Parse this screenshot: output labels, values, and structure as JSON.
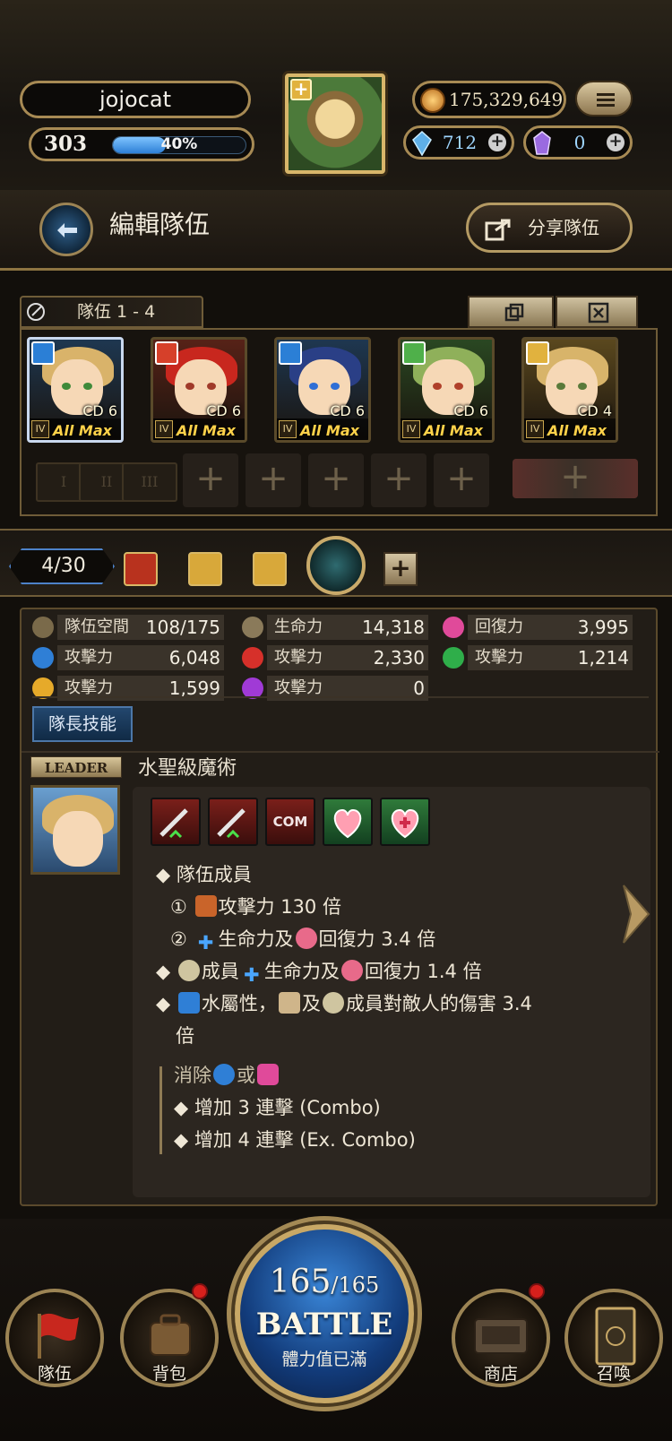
{
  "header": {
    "player_name": "jojocat",
    "level": "303",
    "exp_percent_text": "40%",
    "exp_fraction": 0.4,
    "coins": "175,329,649",
    "diamonds": "712",
    "crystals": "0"
  },
  "edit_bar": {
    "title": "編輯隊伍",
    "share_label": "分享隊伍"
  },
  "team": {
    "label": "隊伍 1 - 4",
    "members": [
      {
        "cd": "CD 6",
        "rank": "IV",
        "status": "All Max",
        "attr_color": "#2b7fd6",
        "hair": "#d9b36a",
        "eye": "#3f8a3a"
      },
      {
        "cd": "CD 6",
        "rank": "IV",
        "status": "All Max",
        "attr_color": "#d6402a",
        "hair": "#c8271e",
        "eye": "#a03a2a"
      },
      {
        "cd": "CD 6",
        "rank": "IV",
        "status": "All Max",
        "attr_color": "#2b7fd6",
        "hair": "#2a3f86",
        "eye": "#2f6fd6"
      },
      {
        "cd": "CD 6",
        "rank": "IV",
        "status": "All Max",
        "attr_color": "#4fb04a",
        "hair": "#8fb05a",
        "eye": "#b0402a"
      },
      {
        "cd": "CD 4",
        "rank": "IV",
        "status": "All Max",
        "attr_color": "#e1b23e",
        "hair": "#d8b46a",
        "eye": "#5a7a3a"
      }
    ],
    "sub_slot_labels": [
      "I",
      "II",
      "III"
    ],
    "cost": "4/30"
  },
  "stats": [
    {
      "icon": "team-space-icon",
      "label": "隊伍空間",
      "value": "108/175",
      "color": "#7a6a4a"
    },
    {
      "icon": "hp-icon",
      "label": "生命力",
      "value": "14,318",
      "color": "#8a7a5a"
    },
    {
      "icon": "recovery-icon",
      "label": "回復力",
      "value": "3,995",
      "color": "#e04a9a"
    },
    {
      "icon": "water-icon",
      "label": "攻擊力",
      "value": "6,048",
      "color": "#2f7fd6"
    },
    {
      "icon": "fire-icon",
      "label": "攻擊力",
      "value": "2,330",
      "color": "#d6302a"
    },
    {
      "icon": "wood-icon",
      "label": "攻擊力",
      "value": "1,214",
      "color": "#2fae4a"
    },
    {
      "icon": "light-icon",
      "label": "攻擊力",
      "value": "1,599",
      "color": "#e6aa2a"
    },
    {
      "icon": "dark-icon",
      "label": "攻擊力",
      "value": "0",
      "color": "#a03ad6"
    }
  ],
  "leader": {
    "tab_label": "隊長技能",
    "tag": "LEADER",
    "skill_name": "水聖級魔術",
    "lines": {
      "b1": "隊伍成員",
      "b1_1a": "①",
      "b1_1b": "攻擊力 130 倍",
      "b1_2a": "②",
      "b1_2b": "生命力及",
      "b1_2c": "回復力 3.4 倍",
      "b2a": "成員",
      "b2b": "生命力及",
      "b2c": "回復力 1.4 倍",
      "b3a": "水屬性，",
      "b3b": "及",
      "b3c": "成員對敵人的傷害 3.4",
      "b3d": "倍",
      "c1a": "消除",
      "c1b": "或",
      "c2": "增加 3 連擊 (Combo)",
      "c3": "增加 4 連擊 (Ex. Combo)"
    },
    "skill_icons": [
      "attack-up-icon",
      "attack-up-icon",
      "combo-icon",
      "heart-icon",
      "heal-icon"
    ],
    "com_text": "COM"
  },
  "nav": {
    "team": "隊伍",
    "bag": "背包",
    "stamina_current": "165",
    "stamina_max": "/165",
    "battle": "BATTLE",
    "stamina_status": "體力值已滿",
    "shop": "商店",
    "summon": "召喚"
  }
}
